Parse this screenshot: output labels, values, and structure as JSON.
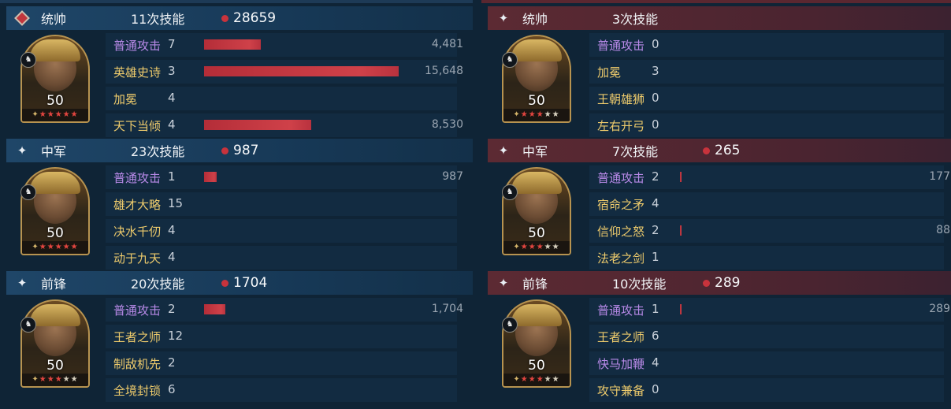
{
  "left_team": {
    "generals": [
      {
        "role": "统帅",
        "role_icon": "red-diamond-gem-icon",
        "skill_count": "11次技能",
        "total_damage": "28659",
        "level": "50",
        "star_rating": 5,
        "skills": [
          {
            "name": "普通攻击",
            "times": "7",
            "color": "purple",
            "damage": "4,481",
            "bar_fraction": 0.29
          },
          {
            "name": "英雄史诗",
            "times": "3",
            "color": "gold",
            "damage": "15,648",
            "bar_fraction": 1.0
          },
          {
            "name": "加冕",
            "times": "4",
            "color": "gold",
            "damage": "",
            "bar_fraction": 0
          },
          {
            "name": "天下当倾",
            "times": "4",
            "color": "gold",
            "damage": "8,530",
            "bar_fraction": 0.55
          }
        ]
      },
      {
        "role": "中军",
        "role_icon": "sparkle-star-icon",
        "skill_count": "23次技能",
        "total_damage": "987",
        "level": "50",
        "star_rating": 5,
        "skills": [
          {
            "name": "普通攻击",
            "times": "1",
            "color": "purple",
            "damage": "987",
            "bar_fraction": 0.065
          },
          {
            "name": "雄才大略",
            "times": "15",
            "color": "gold",
            "damage": "",
            "bar_fraction": 0
          },
          {
            "name": "决水千仞",
            "times": "4",
            "color": "gold",
            "damage": "",
            "bar_fraction": 0
          },
          {
            "name": "动于九天",
            "times": "4",
            "color": "gold",
            "damage": "",
            "bar_fraction": 0
          }
        ]
      },
      {
        "role": "前锋",
        "role_icon": "sparkle-star-icon",
        "skill_count": "20次技能",
        "total_damage": "1704",
        "level": "50",
        "star_rating": 3,
        "skills": [
          {
            "name": "普通攻击",
            "times": "2",
            "color": "purple",
            "damage": "1,704",
            "bar_fraction": 0.11
          },
          {
            "name": "王者之师",
            "times": "12",
            "color": "gold",
            "damage": "",
            "bar_fraction": 0
          },
          {
            "name": "制敌机先",
            "times": "2",
            "color": "gold",
            "damage": "",
            "bar_fraction": 0
          },
          {
            "name": "全境封锁",
            "times": "6",
            "color": "gold",
            "damage": "",
            "bar_fraction": 0
          }
        ]
      }
    ]
  },
  "right_team": {
    "generals": [
      {
        "role": "统帅",
        "role_icon": "sparkle-star-icon",
        "skill_count": "3次技能",
        "total_damage": "",
        "level": "50",
        "star_rating": 3,
        "skills": [
          {
            "name": "普通攻击",
            "times": "0",
            "color": "purple",
            "damage": "",
            "bar_fraction": 0
          },
          {
            "name": "加冕",
            "times": "3",
            "color": "gold",
            "damage": "",
            "bar_fraction": 0
          },
          {
            "name": "王朝雄狮",
            "times": "0",
            "color": "gold",
            "damage": "",
            "bar_fraction": 0
          },
          {
            "name": "左右开弓",
            "times": "0",
            "color": "gold",
            "damage": "",
            "bar_fraction": 0
          }
        ]
      },
      {
        "role": "中军",
        "role_icon": "sparkle-star-icon",
        "skill_count": "7次技能",
        "total_damage": "265",
        "level": "50",
        "star_rating": 3,
        "skills": [
          {
            "name": "普通攻击",
            "times": "2",
            "color": "purple",
            "damage": "177",
            "bar_fraction": 0.006
          },
          {
            "name": "宿命之矛",
            "times": "4",
            "color": "gold",
            "damage": "",
            "bar_fraction": 0
          },
          {
            "name": "信仰之怒",
            "times": "2",
            "color": "gold",
            "damage": "88",
            "bar_fraction": 0.004
          },
          {
            "name": "法老之剑",
            "times": "1",
            "color": "gold",
            "damage": "",
            "bar_fraction": 0
          }
        ]
      },
      {
        "role": "前锋",
        "role_icon": "sparkle-star-icon",
        "skill_count": "10次技能",
        "total_damage": "289",
        "level": "50",
        "star_rating": 3,
        "skills": [
          {
            "name": "普通攻击",
            "times": "1",
            "color": "purple",
            "damage": "289",
            "bar_fraction": 0.009
          },
          {
            "name": "王者之师",
            "times": "6",
            "color": "gold",
            "damage": "",
            "bar_fraction": 0
          },
          {
            "name": "快马加鞭",
            "times": "4",
            "color": "purple",
            "damage": "",
            "bar_fraction": 0
          },
          {
            "name": "攻守兼备",
            "times": "0",
            "color": "gold",
            "damage": "",
            "bar_fraction": 0
          }
        ]
      }
    ]
  },
  "colors": {
    "background": "#0f2436",
    "left_header": "#1f4668",
    "right_header": "#5c2a33",
    "damage_bar": "#c53a43",
    "skill_purple": "#b88ae8",
    "skill_gold": "#eecb6c"
  }
}
